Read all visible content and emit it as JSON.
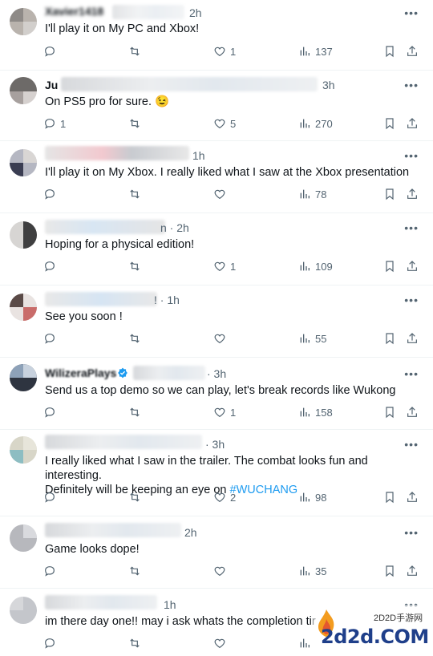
{
  "posts": [
    {
      "name": "Xavier1418",
      "time": "2h",
      "text": "I'll play it on My PC and Xbox!",
      "replies": "",
      "reposts": "",
      "likes": "1",
      "views": "137"
    },
    {
      "name": "Ju",
      "time": "3h",
      "text": "On PS5 pro for sure. 😉",
      "replies": "1",
      "reposts": "",
      "likes": "5",
      "views": "270"
    },
    {
      "name": "",
      "time": "1h",
      "text": "I'll play it on My Xbox. I really liked what I saw at the Xbox presentation",
      "replies": "",
      "reposts": "",
      "likes": "",
      "views": "78"
    },
    {
      "name": "",
      "time": "n · 2h",
      "text": "Hoping for a physical edition!",
      "replies": "",
      "reposts": "",
      "likes": "1",
      "views": "109"
    },
    {
      "name": "",
      "time": "! · 1h",
      "text": "See you soon !",
      "replies": "",
      "reposts": "",
      "likes": "",
      "views": "55"
    },
    {
      "name": "WilizeraPlays",
      "time": "· 3h",
      "text": "Send us a top demo so we can play, let's break records like Wukong",
      "replies": "",
      "reposts": "",
      "likes": "1",
      "views": "158"
    },
    {
      "name": "",
      "time": "· 3h",
      "text_before": "I really liked what I saw in the trailer. The combat looks fun and interesting.\nDefinitely will be keeping an eye on ",
      "hashtag": "#WUCHANG",
      "replies": "",
      "reposts": "",
      "likes": "2",
      "views": "98"
    },
    {
      "name": "",
      "time": "2h",
      "text": "Game looks dope!",
      "replies": "",
      "reposts": "",
      "likes": "",
      "views": "35"
    },
    {
      "name": "",
      "time": "1h",
      "text": "im there day one!! may i ask whats the completion tir",
      "replies": "",
      "reposts": "",
      "likes": "",
      "views": ""
    }
  ],
  "watermark": {
    "logo_text": "2d2d.COM",
    "sub_text": "2D2D手游网"
  },
  "colors": {
    "text": "#0f1419",
    "muted": "#536471",
    "link": "#1d9bf0",
    "verified": "#1d9bf0",
    "divider": "#eff3f4"
  }
}
